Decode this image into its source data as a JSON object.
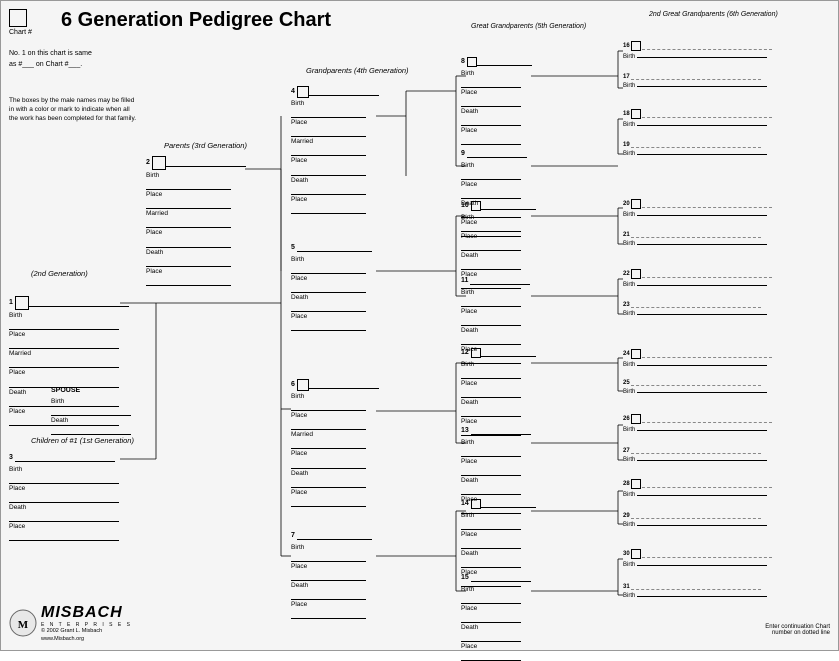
{
  "title": "6 Generation Pedigree Chart",
  "chart_number_label": "Chart #",
  "no1_text": "No. 1 on this chart is same",
  "as_text": "as #___ on Chart #___.",
  "desc_text": "The boxes by the male names may be filled in with a color or mark to indicate when all the work has been completed for that family.",
  "gen2_label": "(2nd Generation)",
  "gen3_label": "Parents (3rd Generation)",
  "gen4_label": "Grandparents (4th Generation)",
  "gen5_label": "Great Grandparents (5th Generation)",
  "gen6_label": "2nd Great Grandparents (6th Generation)",
  "spouse_label": "SPOUSE",
  "children_label": "Children of #1 (1st Generation)",
  "continuation_note": "Enter continuation Chart",
  "continuation_note2": "number on dotted line",
  "copyright": "© 2002 Grant L. Misbach",
  "website": "www.Misbach.org",
  "logo_text": "MISBACH",
  "logo_enterprises": "E N T E R P R I S E S",
  "fields": {
    "birth": "Birth",
    "place": "Place",
    "married": "Married",
    "death": "Death"
  },
  "persons": [
    {
      "num": "1",
      "fields": [
        "Birth",
        "Place",
        "Married",
        "Place",
        "Death",
        "Place"
      ]
    },
    {
      "num": "2",
      "fields": [
        "Birth",
        "Place",
        "Married",
        "Place",
        "Death",
        "Place"
      ]
    },
    {
      "num": "3",
      "fields": [
        "Birth",
        "Place",
        "Death",
        "Place"
      ]
    },
    {
      "num": "4",
      "fields": [
        "Birth",
        "Place",
        "Married",
        "Place",
        "Death",
        "Place"
      ]
    },
    {
      "num": "5",
      "fields": [
        "Birth",
        "Place",
        "Death",
        "Place"
      ]
    },
    {
      "num": "6",
      "fields": [
        "Birth",
        "Place",
        "Married",
        "Place",
        "Death",
        "Place"
      ]
    },
    {
      "num": "7",
      "fields": [
        "Birth",
        "Place",
        "Death",
        "Place"
      ]
    },
    {
      "num": "8",
      "fields": [
        "Birth",
        "Place",
        "Death",
        "Place"
      ]
    },
    {
      "num": "9",
      "fields": [
        "Birth",
        "Place",
        "Death",
        "Place"
      ]
    },
    {
      "num": "10",
      "fields": [
        "Birth",
        "Place",
        "Death",
        "Place"
      ]
    },
    {
      "num": "11",
      "fields": [
        "Birth",
        "Place",
        "Death",
        "Place"
      ]
    },
    {
      "num": "12",
      "fields": [
        "Birth",
        "Place",
        "Death",
        "Place"
      ]
    },
    {
      "num": "13",
      "fields": [
        "Birth",
        "Place",
        "Death",
        "Place"
      ]
    },
    {
      "num": "14",
      "fields": [
        "Birth",
        "Place",
        "Death",
        "Place"
      ]
    },
    {
      "num": "15",
      "fields": [
        "Birth",
        "Place",
        "Death",
        "Place"
      ]
    },
    {
      "num": "16",
      "fields": [
        "Birth"
      ]
    },
    {
      "num": "17",
      "fields": [
        "Birth"
      ]
    },
    {
      "num": "18",
      "fields": [
        "Birth"
      ]
    },
    {
      "num": "19",
      "fields": [
        "Birth"
      ]
    },
    {
      "num": "20",
      "fields": [
        "Birth"
      ]
    },
    {
      "num": "21",
      "fields": [
        "Birth"
      ]
    },
    {
      "num": "22",
      "fields": [
        "Birth"
      ]
    },
    {
      "num": "23",
      "fields": [
        "Birth"
      ]
    },
    {
      "num": "24",
      "fields": [
        "Birth"
      ]
    },
    {
      "num": "25",
      "fields": [
        "Birth"
      ]
    },
    {
      "num": "26",
      "fields": [
        "Birth"
      ]
    },
    {
      "num": "27",
      "fields": [
        "Birth"
      ]
    },
    {
      "num": "28",
      "fields": [
        "Birth"
      ]
    },
    {
      "num": "29",
      "fields": [
        "Birth"
      ]
    },
    {
      "num": "30",
      "fields": [
        "Birth"
      ]
    },
    {
      "num": "31",
      "fields": [
        "Birth"
      ]
    }
  ]
}
